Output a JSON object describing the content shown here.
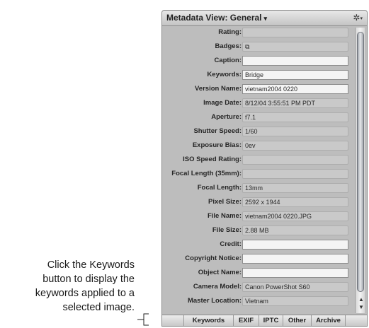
{
  "callout": {
    "lines": [
      "Click the Keywords",
      "button to display the",
      "keywords applied to a",
      "selected image."
    ]
  },
  "panel": {
    "title": "Metadata View: General",
    "title_arrow": "▾",
    "gear_icon": "gear-icon"
  },
  "fields": [
    {
      "label": "Rating:",
      "value": "",
      "editable": false
    },
    {
      "label": "Badges:",
      "value": "",
      "editable": false,
      "icon": "badge-icon"
    },
    {
      "label": "Caption:",
      "value": "",
      "editable": true
    },
    {
      "label": "Keywords:",
      "value": "Bridge",
      "editable": true
    },
    {
      "label": "Version Name:",
      "value": "vietnam2004 0220",
      "editable": true
    },
    {
      "label": "Image Date:",
      "value": "8/12/04 3:55:51 PM PDT",
      "editable": false
    },
    {
      "label": "Aperture:",
      "value": "f7.1",
      "editable": false
    },
    {
      "label": "Shutter Speed:",
      "value": "1/60",
      "editable": false
    },
    {
      "label": "Exposure Bias:",
      "value": "0ev",
      "editable": false
    },
    {
      "label": "ISO Speed Rating:",
      "value": "",
      "editable": false
    },
    {
      "label": "Focal Length (35mm):",
      "value": "",
      "editable": false
    },
    {
      "label": "Focal Length:",
      "value": "13mm",
      "editable": false
    },
    {
      "label": "Pixel Size:",
      "value": "2592 x 1944",
      "editable": false
    },
    {
      "label": "File Name:",
      "value": "vietnam2004 0220.JPG",
      "editable": false
    },
    {
      "label": "File Size:",
      "value": "2.88 MB",
      "editable": false
    },
    {
      "label": "Credit:",
      "value": "",
      "editable": true
    },
    {
      "label": "Copyright Notice:",
      "value": "",
      "editable": true
    },
    {
      "label": "Object Name:",
      "value": "",
      "editable": true
    },
    {
      "label": "Camera Model:",
      "value": "Canon PowerShot S60",
      "editable": false
    },
    {
      "label": "Master Location:",
      "value": "Vietnam",
      "editable": false
    }
  ],
  "tabs": [
    "Keywords",
    "EXIF",
    "IPTC",
    "Other",
    "Archive"
  ],
  "colors": {
    "panel_bg": "#bdbdbd",
    "field_readonly": "#c9c9c9",
    "field_editable": "#f4f4f4"
  }
}
